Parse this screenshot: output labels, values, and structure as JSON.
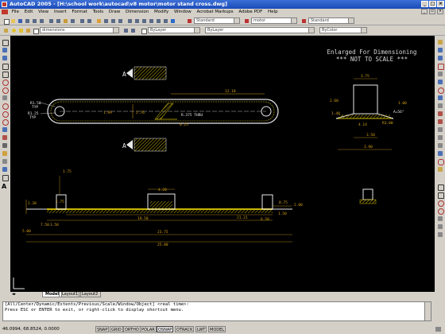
{
  "window": {
    "title": "AutoCAD 2005 - [H:\\school work\\autocad\\v8 motor\\motor stand cross.dwg]"
  },
  "menu": [
    "File",
    "Edit",
    "View",
    "Insert",
    "Format",
    "Tools",
    "Draw",
    "Dimension",
    "Modify",
    "Window",
    "Acrobat Markups",
    "Adobe PDF",
    "Help"
  ],
  "toolbar": {
    "text_style": "Standard",
    "dim_style": "motor",
    "table_style": "Standard",
    "layer": "dimensions",
    "color": "ByLayer",
    "linetype": "ByLayer",
    "lineweight": "ByColor"
  },
  "drawing": {
    "note_line1": "Enlarged For Dimensioning",
    "note_line2": "*** NOT TO SCALE ***",
    "section_label": "A",
    "dims": {
      "d1210": "12.10",
      "d199": "1.99",
      "d276": "2.76",
      "r150": "R1.50",
      "tip": "TYP",
      "r125": "R1.25",
      "r375": "R.375 THRU",
      "d025": "0.25",
      "d175a": "1.75",
      "d175b": "1.75",
      "d238": "2.38",
      "d420": "4.20",
      "d1950": "19.50",
      "d2121": "21.21",
      "d2375": "23.75",
      "d750": "7.50",
      "d350": "3.50",
      "d500": "5.00",
      "d2500": "25.00",
      "d650": "6.50",
      "d075": "0.75",
      "d200": "2.00",
      "d150": "1.50",
      "d260": "2.60",
      "d375": "3.75",
      "d100": "1.00",
      "d140": "1.40",
      "d414": "4.14",
      "d350b": "3.50",
      "d390": "3.90",
      "ang": "A=56°",
      "r300": "R3.00"
    }
  },
  "layout_tabs": [
    "Model",
    "Layout1",
    "Layout2"
  ],
  "command": {
    "line1": "[All/Center/Dynamic/Extents/Previous/Scale/Window/Object] <real time>:",
    "line2": "Press ESC or ENTER to exit, or right-click to display shortcut menu."
  },
  "status": {
    "coords": "46.0994, 68.8524, 0.0000",
    "toggles": [
      "SNAP",
      "GRID",
      "ORTHO",
      "POLAR",
      "OSNAP",
      "OTRACK",
      "LWT",
      "MODEL"
    ]
  },
  "colors": {
    "canvas": "#000000",
    "geometry": "#e8e8e8",
    "dims": "#d4a017",
    "hatch": "#c8b400"
  }
}
